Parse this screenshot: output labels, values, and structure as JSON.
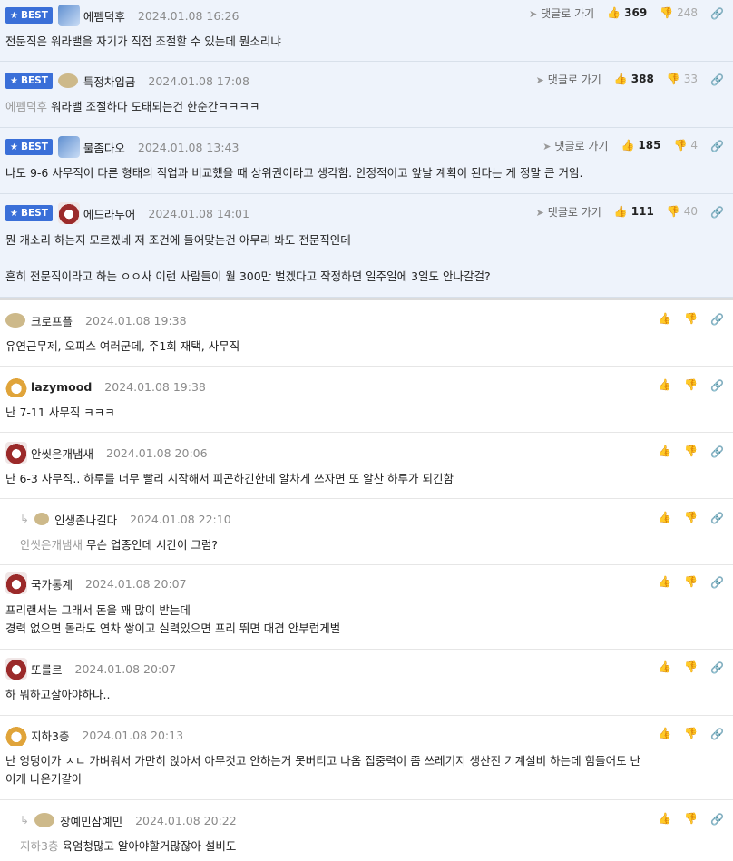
{
  "labels": {
    "best": "BEST",
    "goto": "댓글로 가기"
  },
  "icons": {
    "star": "★",
    "up": "👍",
    "down": "👎",
    "link": "🔗",
    "goto": "➤",
    "reply": "↳"
  },
  "best_comments": [
    {
      "nick": "에펨덕후",
      "date": "2024.01.08 16:26",
      "up": "369",
      "down": "248",
      "mention": "",
      "text": "전문직은 워라밸을 자기가 직접 조절할 수 있는데 뭔소리냐"
    },
    {
      "nick": "특정차입금",
      "date": "2024.01.08 17:08",
      "up": "388",
      "down": "33",
      "mention": "에펨덕후",
      "text": "워라밸 조절하다 도태되는건 한순간ㅋㅋㅋㅋ"
    },
    {
      "nick": "물좀다오",
      "date": "2024.01.08 13:43",
      "up": "185",
      "down": "4",
      "mention": "",
      "text": "나도 9-6 사무직이 다른 형태의 직업과 비교했을 때 상위권이라고 생각함. 안정적이고 앞날 계획이 된다는 게 정말 큰 거임."
    },
    {
      "nick": "에드라두어",
      "date": "2024.01.08 14:01",
      "up": "111",
      "down": "40",
      "mention": "",
      "text": "뭔 개소리 하는지 모르겠네 저 조건에 들어맞는건 아무리 봐도 전문직인데\n\n흔히 전문직이라고 하는 ㅇㅇ사 이런 사람들이 월 300만 벌겠다고 작정하면 일주일에 3일도 안나갈걸?"
    }
  ],
  "comments": [
    {
      "nick": "크로프플",
      "date": "2024.01.08 19:38",
      "mention": "",
      "text": "유연근무제, 오피스 여러군데, 주1회 재택, 사무직"
    },
    {
      "nick": "lazymood",
      "date": "2024.01.08 19:38",
      "mention": "",
      "text": "난 7-11 사무직 ㅋㅋㅋ"
    },
    {
      "nick": "안씻은개냄새",
      "date": "2024.01.08 20:06",
      "mention": "",
      "text": "난 6-3 사무직.. 하루를 너무 빨리 시작해서 피곤하긴한데 알차게 쓰자면 또 알찬 하루가 되긴함"
    },
    {
      "nick": "인생존나길다",
      "date": "2024.01.08 22:10",
      "mention": "안씻은개냄새",
      "text": "무슨 업종인데 시간이 그럼?"
    },
    {
      "nick": "국가통계",
      "date": "2024.01.08 20:07",
      "mention": "",
      "text": "프리랜서는 그래서 돈을 꽤 많이 받는데\n경력 없으면 몰라도 연차 쌓이고 실력있으면 프리 뛰면 대겹 안부럽게벌"
    },
    {
      "nick": "또를르",
      "date": "2024.01.08 20:07",
      "mention": "",
      "text": "하 뭐하고살아야하나.."
    },
    {
      "nick": "지하3층",
      "date": "2024.01.08 20:13",
      "mention": "",
      "text": "난 엉덩이가 ㅈㄴ 가벼워서 가만히 앉아서 아무것고 안하는거 못버티고 나옴 집중력이 좀 쓰레기지 생산진 기계설비 하는데 힘들어도 난\n이게 나온거같아"
    },
    {
      "nick": "장예민잠예민",
      "date": "2024.01.08 20:22",
      "mention": "지하3층",
      "text": "육엄청많고 알아야할거많잖아 설비도"
    }
  ]
}
